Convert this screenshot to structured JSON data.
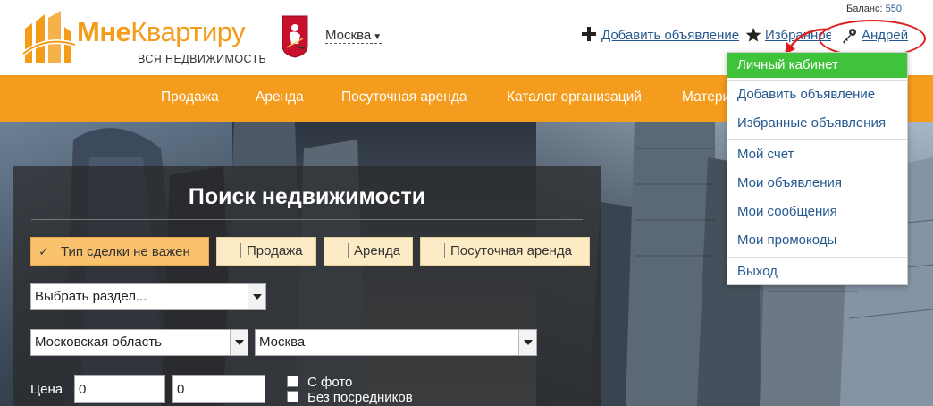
{
  "header": {
    "logo": {
      "title_bold": "Мне",
      "title_light": "Квартиру",
      "subtitle": "ВСЯ НЕДВИЖИМОСТЬ"
    },
    "city": {
      "label": "Москва"
    },
    "balance": {
      "label": "Баланс:",
      "value": "550"
    },
    "add_listing": "Добавить объявление",
    "favorites": "Избранное",
    "user_name": "Андрей"
  },
  "nav": {
    "items": [
      "Продажа",
      "Аренда",
      "Посуточная аренда",
      "Каталог организаций",
      "Материалы"
    ]
  },
  "search": {
    "title": "Поиск недвижимости",
    "deal_types": [
      {
        "label": "Тип сделки не важен",
        "active": true
      },
      {
        "label": "Продажа",
        "active": false
      },
      {
        "label": "Аренда",
        "active": false
      },
      {
        "label": "Посуточная аренда",
        "active": false
      }
    ],
    "section_select": "Выбрать раздел...",
    "region_select": "Московская область",
    "city_select": "Москва",
    "price_label": "Цена",
    "price_from": "0",
    "price_to": "0",
    "with_photo": "С фото",
    "no_agents": "Без посредников"
  },
  "user_menu": {
    "items": [
      "Личный кабинет",
      "Добавить объявление",
      "Избранные объявления",
      "Мой счет",
      "Мои объявления",
      "Мои сообщения",
      "Мои промокоды",
      "Выход"
    ]
  },
  "colors": {
    "brand_orange": "#f49c1e",
    "link_blue": "#24588f",
    "menu_active_green": "#3ec33b",
    "annotation_red": "#e01b1b"
  }
}
